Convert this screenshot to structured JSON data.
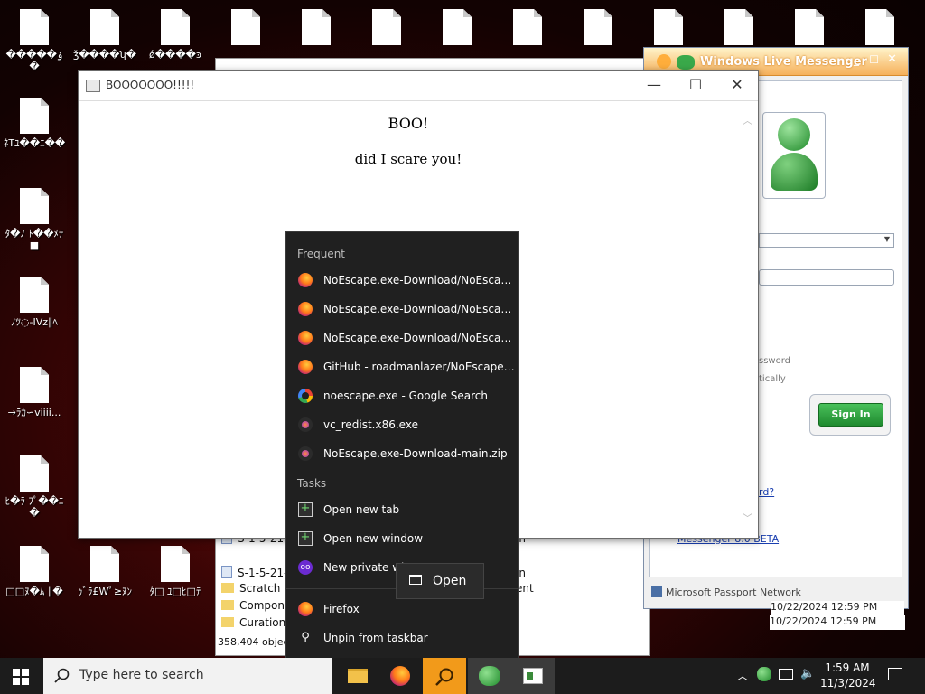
{
  "desktop": {
    "top_row": [
      "�����ݸ�",
      "ǯ����ʮ�",
      "ǿ����ͽ",
      "",
      "",
      "",
      "",
      "",
      "",
      "",
      "",
      "",
      ""
    ],
    "left_column": [
      {
        "label": "ﾈTﾕ��ﾆ��"
      },
      {
        "label": "ﾀ�ﾉ ﾄ��ﾒﾃ■"
      },
      {
        "label": "ﾉﾂ◌-IVz∥ﾍ"
      },
      {
        "label": "→ﾗｶ∽viiii..."
      },
      {
        "label": "ﾋ�ﾗ ﾌﾟ��ﾆ�"
      },
      {
        "label": "□□ﾇ�ﾑ ∥�"
      }
    ],
    "bottom_row": [
      {
        "label": "ｩﾞﾗ£Wﾟ≥ﾇﾝ"
      },
      {
        "label": "ﾀ□ ﾕ□ﾋ□ﾃ"
      }
    ]
  },
  "explorer": {
    "items": [
      {
        "name": "S-1-5-21-3",
        "type": "file",
        "extra": "in"
      },
      {
        "name": "S-1-5-21-3",
        "type": "file",
        "extra": "in"
      },
      {
        "name": "Scratch",
        "type": "folder",
        "extra": "ent"
      },
      {
        "name": "Componen",
        "type": "folder",
        "extra": ""
      },
      {
        "name": "Curations",
        "type": "folder",
        "extra": ""
      }
    ],
    "status": "358,404 objects"
  },
  "popup": {
    "title": "BOOOOOOO!!!!!",
    "heading": "BOO!",
    "body": "did I scare you!",
    "minimize": "—",
    "maximize": "☐",
    "close": "✕"
  },
  "messenger": {
    "title": "Windows Live Messenger",
    "password_hint": "ssword",
    "auto_hint": "tically",
    "sign_in": "Sign In",
    "forgot_link": "rd?",
    "beta_link": "Messenger 8.0 BETA",
    "footer": "Microsoft Passport Network",
    "dates": [
      "10/22/2024 12:59 PM",
      "10/22/2024 12:59 PM"
    ],
    "accent": "#2e9d3a"
  },
  "jumplist": {
    "frequent_label": "Frequent",
    "frequent": [
      {
        "label": "NoEscape.exe-Download/NoEscape.ex...",
        "icon": "firefox-icon"
      },
      {
        "label": "NoEscape.exe-Download/NoEscape.ex...",
        "icon": "firefox-icon"
      },
      {
        "label": "NoEscape.exe-Download/NoEscape.ex...",
        "icon": "firefox-icon"
      },
      {
        "label": "GitHub - roadmanlazer/NoEscape.exe-...",
        "icon": "firefox-icon"
      },
      {
        "label": "noescape.exe - Google Search",
        "icon": "google-icon"
      },
      {
        "label": "vc_redist.x86.exe",
        "icon": "download-icon"
      },
      {
        "label": "NoEscape.exe-Download-main.zip",
        "icon": "download-icon"
      }
    ],
    "tasks_label": "Tasks",
    "tasks": [
      {
        "label": "Open new tab",
        "icon": "plus-icon"
      },
      {
        "label": "Open new window",
        "icon": "plus-icon"
      },
      {
        "label": "New private wi",
        "icon": "private-mask-icon"
      }
    ],
    "app": {
      "label": "Firefox",
      "icon": "firefox-icon"
    },
    "unpin": {
      "label": "Unpin from taskbar",
      "icon": "unpin-icon"
    },
    "tooltip": "Open"
  },
  "taskbar": {
    "search_placeholder": "Type here to search",
    "time": "1:59 AM",
    "date": "11/3/2024"
  }
}
